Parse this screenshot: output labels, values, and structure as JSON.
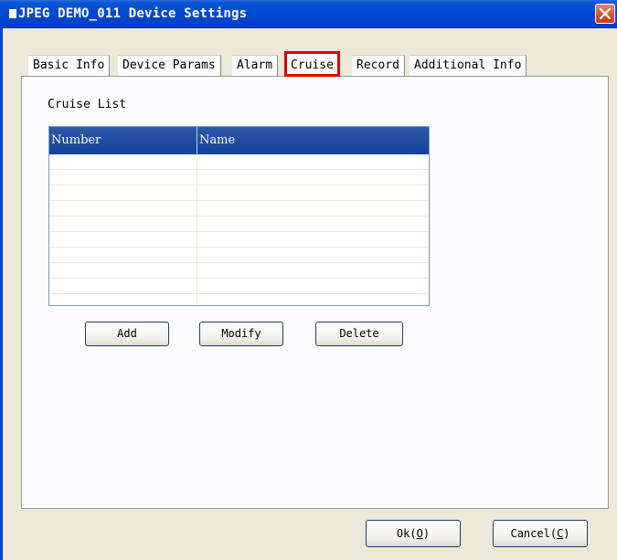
{
  "window": {
    "title": "JPEG DEMO_011 Device Settings",
    "close_icon": "close-icon"
  },
  "tabs": [
    {
      "label": "Basic Info",
      "active": false
    },
    {
      "label": "Device Params",
      "active": false
    },
    {
      "label": "Alarm",
      "active": false
    },
    {
      "label": "Cruise",
      "active": true
    },
    {
      "label": "Record",
      "active": false
    },
    {
      "label": "Additional Info",
      "active": false
    }
  ],
  "cruise": {
    "section_label": "Cruise List",
    "columns": [
      "Number",
      "Name"
    ],
    "rows": [],
    "add_label": "Add",
    "modify_label": "Modify",
    "delete_label": "Delete"
  },
  "footer": {
    "ok_label": "Ok",
    "ok_key": "O",
    "cancel_label": "Cancel",
    "cancel_key": "C"
  },
  "colors": {
    "titlebar": "#0048d0",
    "list_header": "#1f4ea2",
    "highlight_border": "#e00000",
    "dialog_bg": "#ece9d8"
  }
}
